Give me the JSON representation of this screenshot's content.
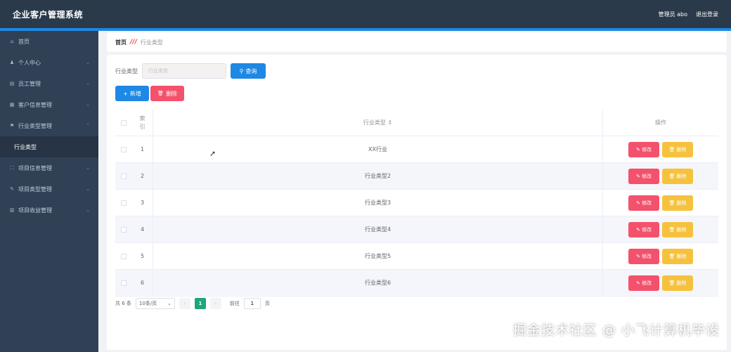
{
  "header": {
    "title": "企业客户管理系统",
    "user": "管理员 abo",
    "logout": "退出登录"
  },
  "sidebar": {
    "items": [
      {
        "icon": "⌂",
        "label": "首页",
        "chev": ""
      },
      {
        "icon": "♟",
        "label": "个人中心",
        "chev": "⌄"
      },
      {
        "icon": "▤",
        "label": "员工管理",
        "chev": "⌄"
      },
      {
        "icon": "▦",
        "label": "客户信息管理",
        "chev": "⌄"
      },
      {
        "icon": "⚑",
        "label": "行业类型管理",
        "chev": "⌃"
      }
    ],
    "active_sub": "行业类型",
    "items2": [
      {
        "icon": "⛶",
        "label": "项目信息管理",
        "chev": "⌄"
      },
      {
        "icon": "✎",
        "label": "项目类型管理",
        "chev": "⌄"
      },
      {
        "icon": "▥",
        "label": "项目收益管理",
        "chev": "⌄"
      }
    ]
  },
  "breadcrumb": {
    "home": "首页",
    "sep": "///",
    "current": "行业类型"
  },
  "search": {
    "label": "行业类型",
    "placeholder": "行业类型",
    "button": "查询",
    "icon": "⚲"
  },
  "actions": {
    "add": "新增",
    "add_icon": "+",
    "delete": "删除",
    "delete_icon": "🗑"
  },
  "table": {
    "headers": {
      "index": "索引",
      "type": "行业类型 ⇕",
      "ops": "操作"
    },
    "rows": [
      {
        "index": "1",
        "type": "XX行业"
      },
      {
        "index": "2",
        "type": "行业类型2"
      },
      {
        "index": "3",
        "type": "行业类型3"
      },
      {
        "index": "4",
        "type": "行业类型4"
      },
      {
        "index": "5",
        "type": "行业类型5"
      },
      {
        "index": "6",
        "type": "行业类型6"
      }
    ],
    "edit_label": "✎ 修改",
    "remove_label": "🗑 删除"
  },
  "pagination": {
    "total": "共 6 条",
    "page_size": "10条/页",
    "prev": "‹",
    "current": "1",
    "next": "›",
    "goto": "前往",
    "goto_value": "1",
    "page_unit": "页"
  },
  "watermark": "掘金技术社区 @ 小飞计算机毕设"
}
